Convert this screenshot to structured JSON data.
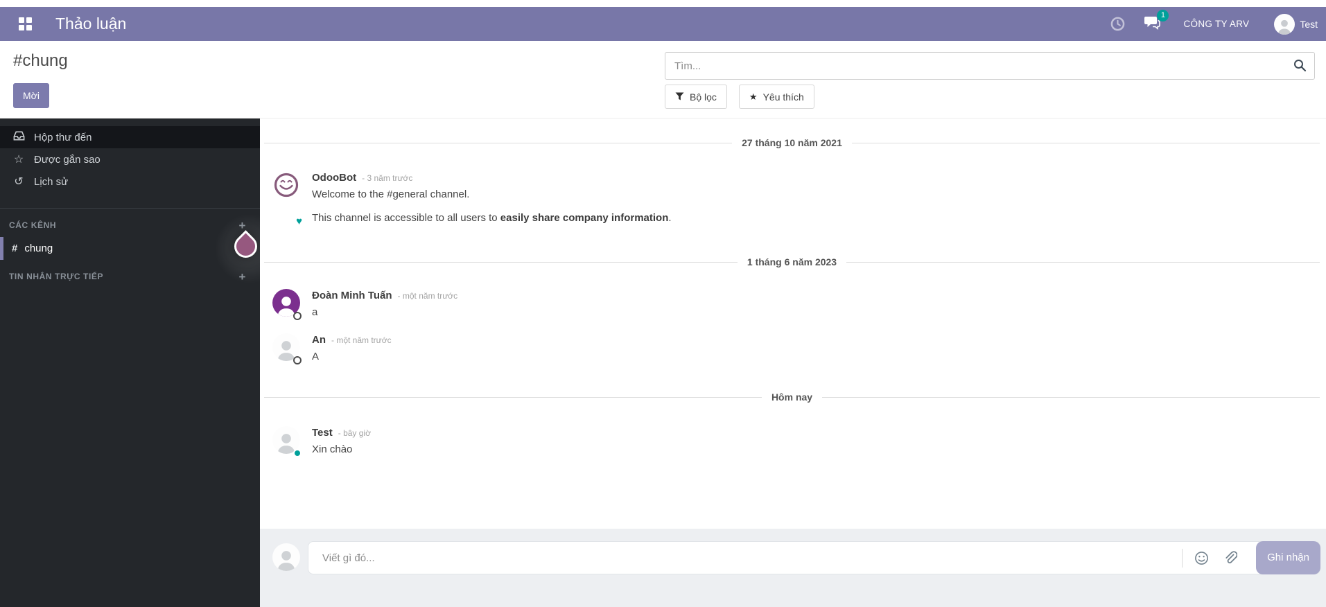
{
  "colors": {
    "topbar": "#7877a8",
    "accent": "#7c7bad",
    "log_button": "#a8a8ca",
    "teal": "#00a09a",
    "sidebar_bg": "#24272b",
    "sidebar_active": "#14161a",
    "channel_accent": "#8280ae",
    "odoobot": "#875a7b",
    "user_purple": "#7b2f8e",
    "droplet": "#96587f"
  },
  "navbar": {
    "title": "Thảo luận",
    "badge_count": "1",
    "company": "CÔNG TY ARV",
    "user": "Test"
  },
  "header": {
    "channel_title": "#chung",
    "invite_label": "Mời",
    "search_placeholder": "Tìm...",
    "filter_label": "Bộ lọc",
    "favorite_label": "Yêu thích",
    "filter_glyph": "▼",
    "favorite_glyph": "★"
  },
  "sidebar": {
    "mailboxes": [
      {
        "label": "Hộp thư đến"
      },
      {
        "label": "Được gắn sao",
        "glyph": "☆"
      },
      {
        "label": "Lịch sử",
        "glyph": "↺"
      }
    ],
    "channels_header": "CÁC KÊNH",
    "dm_header": "TIN NHẮN TRỰC TIẾP",
    "add_glyph": "+",
    "channel": {
      "hash": "#",
      "name": "chung"
    }
  },
  "chat": {
    "separators": [
      "27 tháng 10 năm 2021",
      "1 tháng 6 năm 2023",
      "Hôm nay"
    ],
    "messages": [
      {
        "author": "OdooBot",
        "time": "- 3 năm trước",
        "body": "Welcome to the #general channel.",
        "body2_pre": "This channel is accessible to all users to ",
        "body2_bold": "easily share company information",
        "body2_post": "."
      },
      {
        "author": "Đoàn Minh Tuấn",
        "time": "- một năm trước",
        "body": "a"
      },
      {
        "author": "An",
        "time": "- một năm trước",
        "body": "A"
      },
      {
        "author": "Test",
        "time": "- bây giờ",
        "body": "Xin chào"
      }
    ],
    "heart_glyph": "♥"
  },
  "composer": {
    "placeholder": "Viết gì đó...",
    "log_label": "Ghi nhận"
  }
}
